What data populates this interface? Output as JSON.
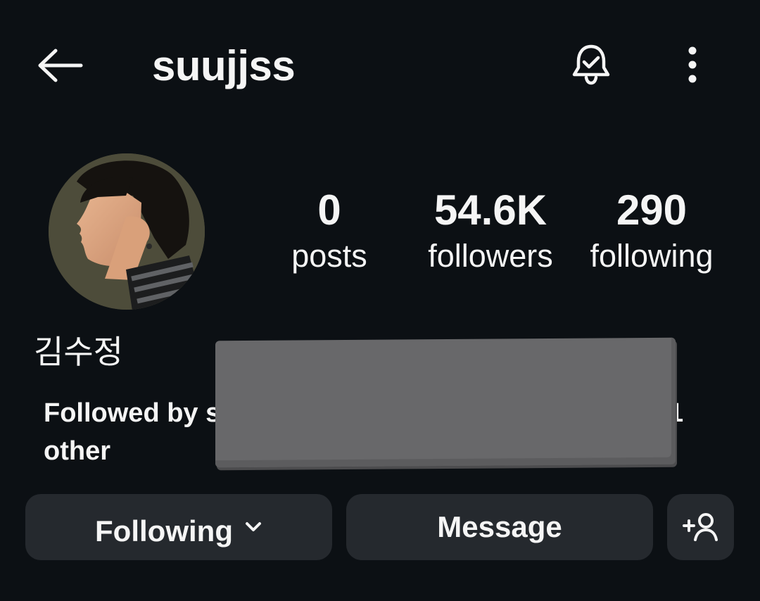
{
  "header": {
    "username": "suujjss",
    "back_icon": "arrow-left-icon",
    "bell_icon": "bell-check-icon",
    "more_icon": "more-vertical-icon"
  },
  "profile": {
    "full_name": "김수정",
    "stats": [
      {
        "value": "0",
        "label": "posts"
      },
      {
        "value": "54.6K",
        "label": "followers"
      },
      {
        "value": "290",
        "label": "following"
      }
    ],
    "followed_by": {
      "prefix": "Followed by s",
      "tail": "1",
      "line2": "other"
    }
  },
  "actions": {
    "following_label": "Following",
    "message_label": "Message",
    "suggest_icon": "add-person-icon"
  },
  "colors": {
    "background": "#0c1014",
    "button": "#25292e",
    "text": "#f5f5f5",
    "redaction": "#68686a"
  }
}
